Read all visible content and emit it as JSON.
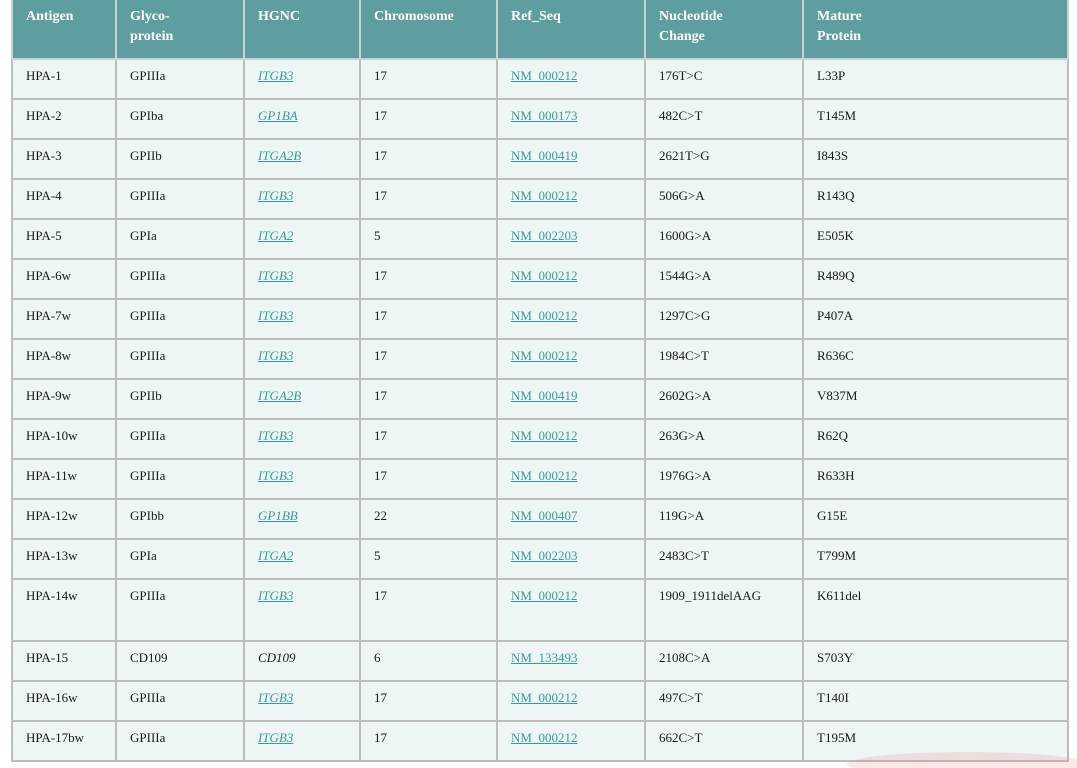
{
  "columns": [
    "Antigen",
    "Glyco-\nprotein",
    "HGNC",
    "Chromosome",
    "Ref_Seq",
    "Nucleotide\nChange",
    "Mature\nProtein"
  ],
  "rows": [
    {
      "antigen": "HPA-1",
      "glyco": "GPIIIa",
      "hgnc": "ITGB3",
      "hgnc_link": true,
      "chr": "17",
      "refseq": "NM_000212",
      "nuc": "176T>C",
      "protein": "L33P"
    },
    {
      "antigen": "HPA-2",
      "glyco": "GPIba",
      "hgnc": "GP1BA",
      "hgnc_link": true,
      "chr": "17",
      "refseq": "NM_000173",
      "nuc": "482C>T",
      "protein": "T145M"
    },
    {
      "antigen": "HPA-3",
      "glyco": "GPIIb",
      "hgnc": "ITGA2B",
      "hgnc_link": true,
      "chr": "17",
      "refseq": "NM_000419",
      "nuc": "2621T>G",
      "protein": "I843S"
    },
    {
      "antigen": "HPA-4",
      "glyco": "GPIIIa",
      "hgnc": "ITGB3",
      "hgnc_link": true,
      "chr": "17",
      "refseq": "NM_000212",
      "nuc": "506G>A",
      "protein": "R143Q"
    },
    {
      "antigen": "HPA-5",
      "glyco": "GPIa",
      "hgnc": "ITGA2",
      "hgnc_link": true,
      "chr": "5",
      "refseq": "NM_002203",
      "nuc": "1600G>A",
      "protein": "E505K"
    },
    {
      "antigen": "HPA-6w",
      "glyco": "GPIIIa",
      "hgnc": "ITGB3",
      "hgnc_link": true,
      "chr": "17",
      "refseq": "NM_000212",
      "nuc": "1544G>A",
      "protein": "R489Q"
    },
    {
      "antigen": "HPA-7w",
      "glyco": "GPIIIa",
      "hgnc": "ITGB3",
      "hgnc_link": true,
      "chr": "17",
      "refseq": "NM_000212",
      "nuc": "1297C>G",
      "protein": "P407A"
    },
    {
      "antigen": "HPA-8w",
      "glyco": "GPIIIa",
      "hgnc": "ITGB3",
      "hgnc_link": true,
      "chr": "17",
      "refseq": "NM_000212",
      "nuc": "1984C>T",
      "protein": "R636C"
    },
    {
      "antigen": "HPA-9w",
      "glyco": "GPIIb",
      "hgnc": "ITGA2B",
      "hgnc_link": true,
      "chr": "17",
      "refseq": "NM_000419",
      "nuc": "2602G>A",
      "protein": "V837M"
    },
    {
      "antigen": "HPA-10w",
      "glyco": "GPIIIa",
      "hgnc": "ITGB3",
      "hgnc_link": true,
      "chr": "17",
      "refseq": "NM_000212",
      "nuc": "263G>A",
      "protein": "R62Q"
    },
    {
      "antigen": "HPA-11w",
      "glyco": "GPIIIa",
      "hgnc": "ITGB3",
      "hgnc_link": true,
      "chr": "17",
      "refseq": "NM_000212",
      "nuc": "1976G>A",
      "protein": "R633H"
    },
    {
      "antigen": "HPA-12w",
      "glyco": "GPIbb",
      "hgnc": "GP1BB",
      "hgnc_link": true,
      "chr": "22",
      "refseq": "NM_000407",
      "nuc": "119G>A",
      "protein": "G15E"
    },
    {
      "antigen": "HPA-13w",
      "glyco": "GPIa",
      "hgnc": "ITGA2",
      "hgnc_link": true,
      "chr": "5",
      "refseq": "NM_002203",
      "nuc": "2483C>T",
      "protein": "T799M"
    },
    {
      "antigen": "HPA-14w",
      "glyco": "GPIIIa",
      "hgnc": "ITGB3",
      "hgnc_link": true,
      "chr": "17",
      "refseq": "NM_000212",
      "nuc": "1909_1911delAAG",
      "protein": "K611del"
    },
    {
      "antigen": "HPA-15",
      "glyco": "CD109",
      "hgnc": "CD109",
      "hgnc_link": false,
      "chr": "6",
      "refseq": "NM_133493",
      "nuc": "2108C>A",
      "protein": "S703Y"
    },
    {
      "antigen": "HPA-16w",
      "glyco": "GPIIIa",
      "hgnc": "ITGB3",
      "hgnc_link": true,
      "chr": "17",
      "refseq": "NM_000212",
      "nuc": "497C>T",
      "protein": "T140I"
    },
    {
      "antigen": "HPA-17bw",
      "glyco": "GPIIIa",
      "hgnc": "ITGB3",
      "hgnc_link": true,
      "chr": "17",
      "refseq": "NM_000212",
      "nuc": "662C>T",
      "protein": "T195M"
    }
  ],
  "colors": {
    "header_bg": "#5f9ea0",
    "row_bg": "#edf5f5",
    "link": "#3a9b9b"
  }
}
